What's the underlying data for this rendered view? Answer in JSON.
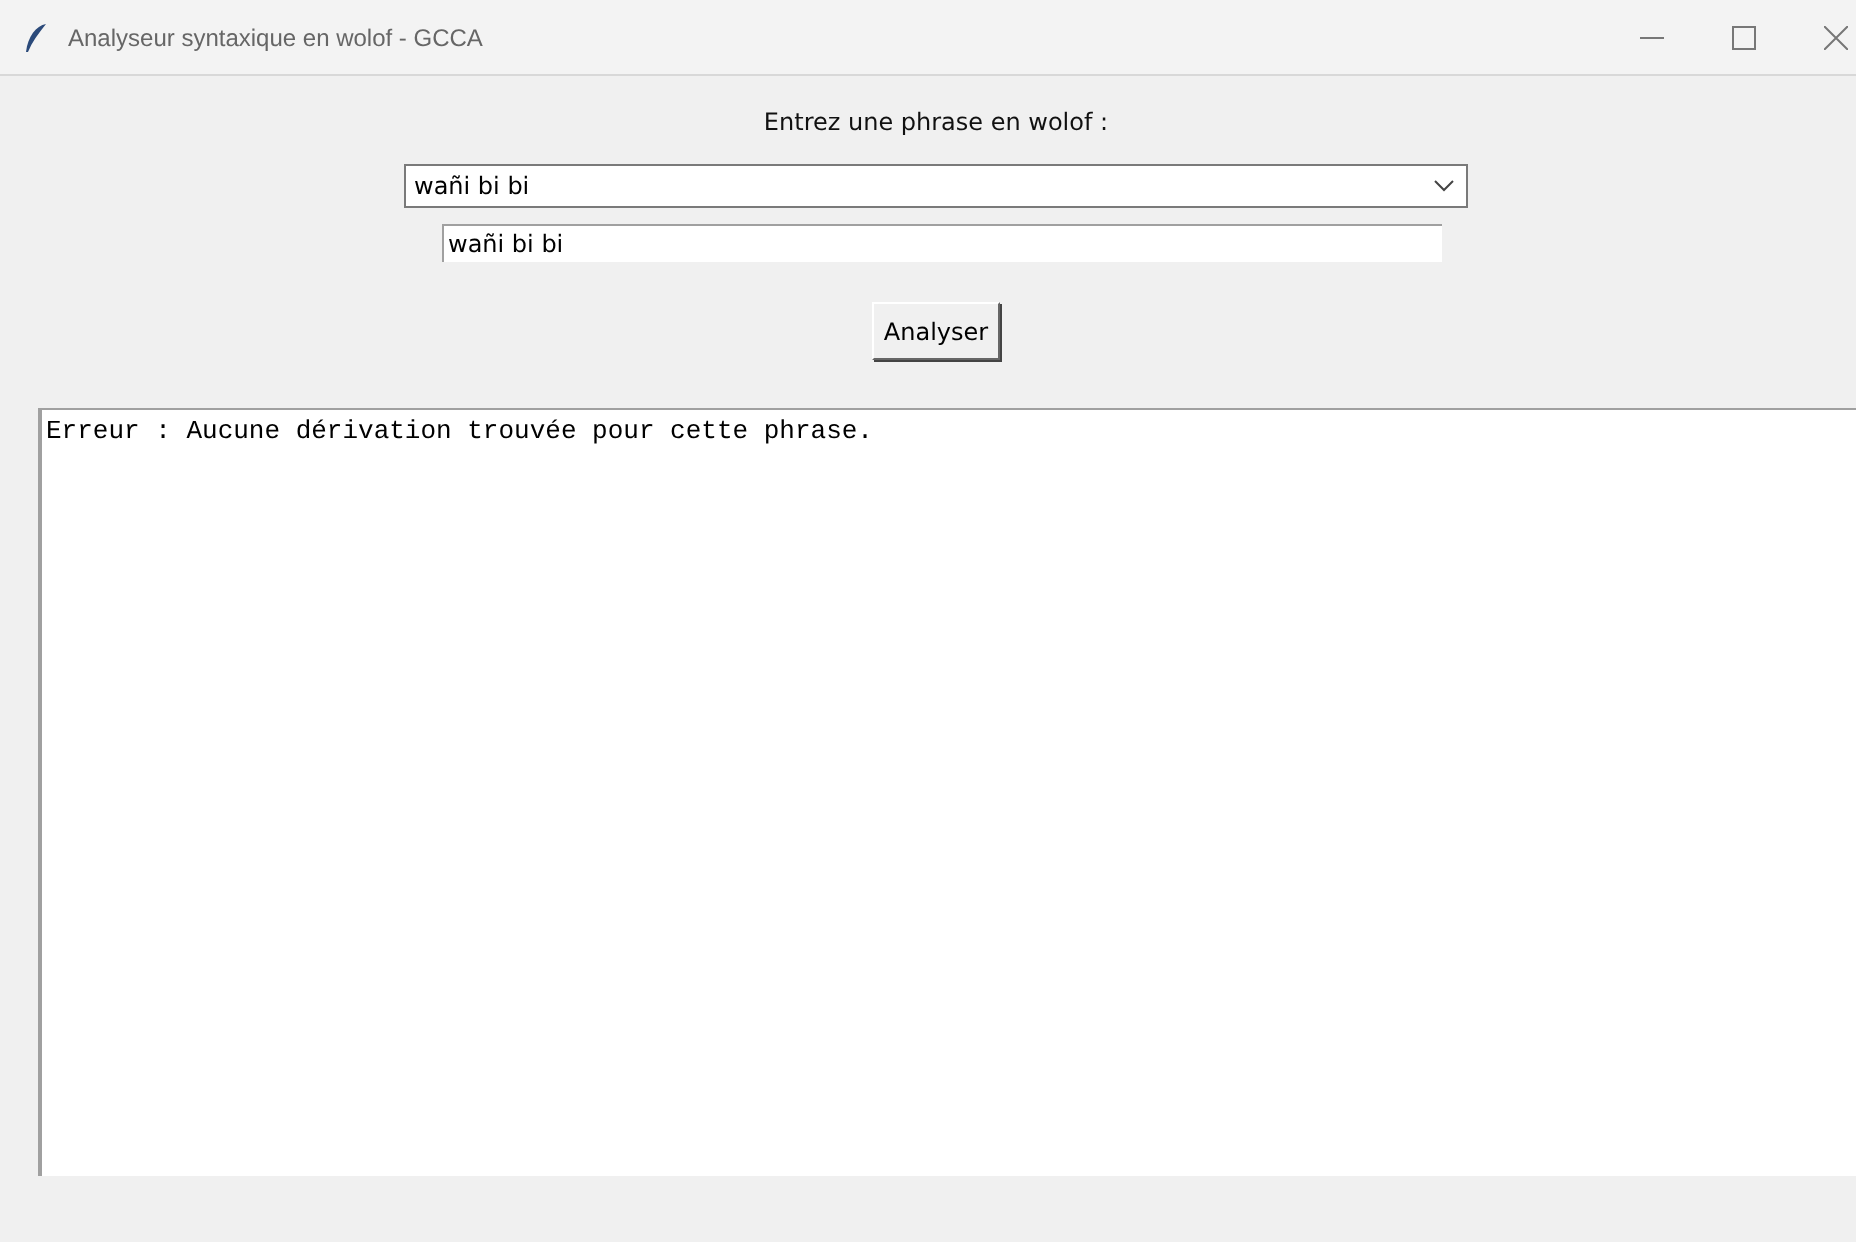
{
  "window": {
    "title": "Analyseur syntaxique en wolof - GCCA"
  },
  "prompt": "Entrez une phrase en wolof :",
  "combobox": {
    "value": "wañi bi bi"
  },
  "entry": {
    "value": "wañi bi bi"
  },
  "button": "Analyser",
  "output": "Erreur : Aucune dérivation trouvée pour cette phrase."
}
